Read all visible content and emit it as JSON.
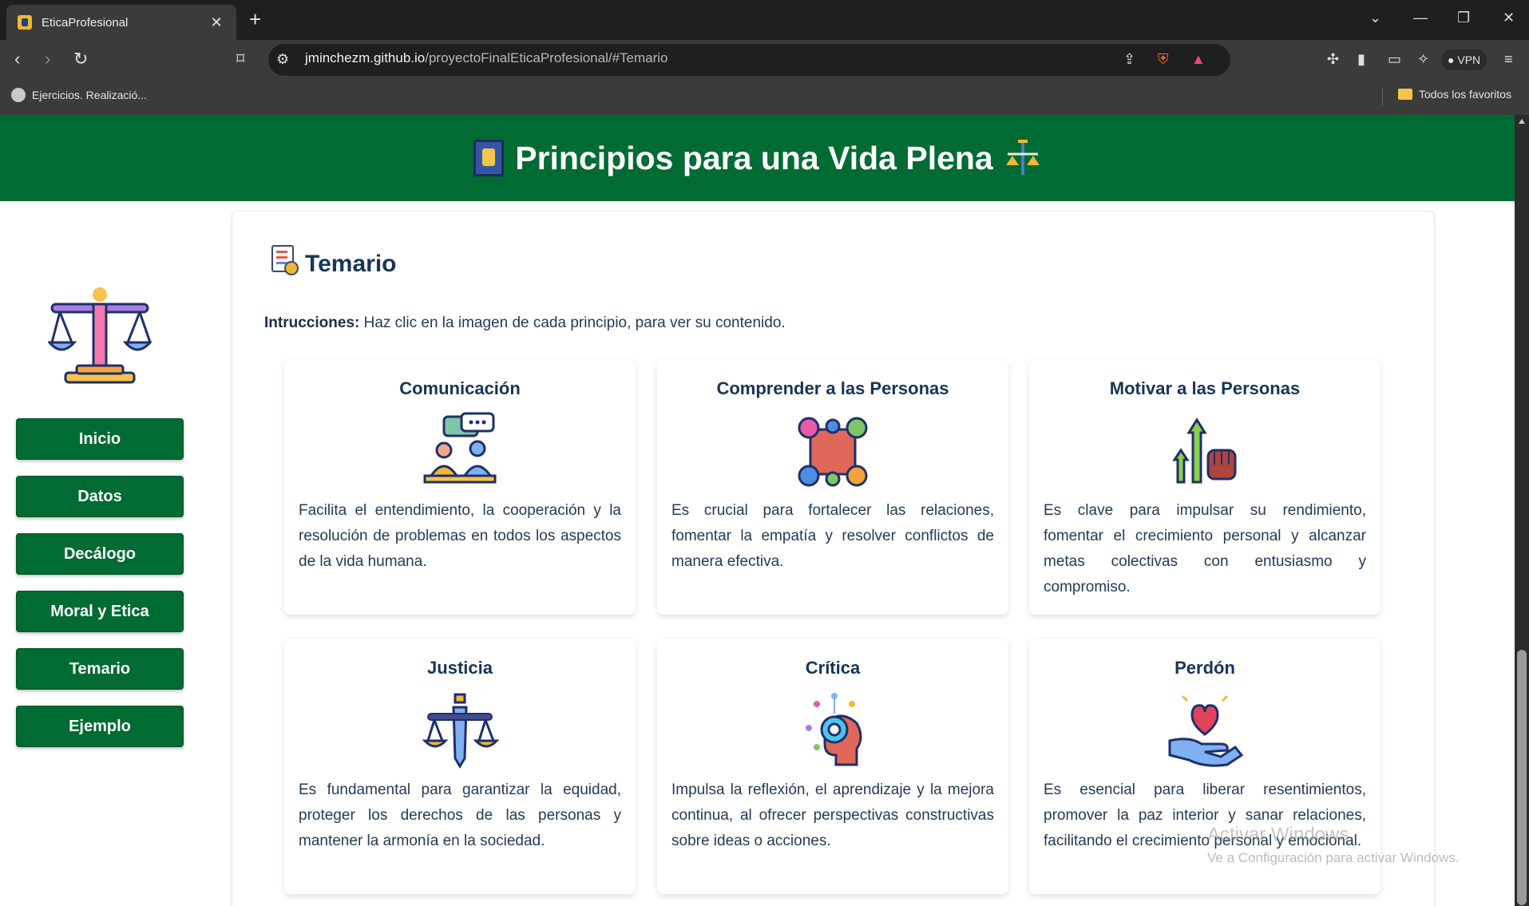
{
  "browser": {
    "tab_title": "EticaProfesional",
    "url_host": "jminchezm.github.io",
    "url_path": "/proyectoFinalEticaProfesional/#Temario",
    "vpn_label": "VPN",
    "bookmark_left": "Ejercicios. Realizació...",
    "bookmark_right": "Todos los favoritos"
  },
  "header": {
    "title": "Principios para una Vida Plena"
  },
  "sidebar": {
    "items": [
      {
        "label": "Inicio"
      },
      {
        "label": "Datos"
      },
      {
        "label": "Decálogo"
      },
      {
        "label": "Moral y Etica"
      },
      {
        "label": "Temario"
      },
      {
        "label": "Ejemplo"
      }
    ]
  },
  "main": {
    "section_title": "Temario",
    "instructions_label": "Intrucciones:",
    "instructions_text": " Haz clic en la imagen de cada principio, para ver su contenido.",
    "principles": [
      {
        "title": "Comunicación",
        "icon": "communication-icon",
        "text": "Facilita el entendimiento, la cooperación y la resolución de problemas en todos los aspectos de la vida humana."
      },
      {
        "title": "Comprender a las Personas",
        "icon": "puzzle-people-icon",
        "text": "Es crucial para fortalecer las relaciones, fomentar la empatía y resolver conflictos de manera efectiva."
      },
      {
        "title": "Motivar a las Personas",
        "icon": "motivation-fist-icon",
        "text": "Es clave para impulsar su rendimiento, fomentar el crecimiento personal y alcanzar metas colectivas con entusiasmo y compromiso."
      },
      {
        "title": "Justicia",
        "icon": "justice-scale-icon",
        "text": "Es fundamental para garantizar la equidad, proteger los derechos de las personas y mantener la armonía en la sociedad."
      },
      {
        "title": "Crítica",
        "icon": "critical-thinking-icon",
        "text": "Impulsa la reflexión, el aprendizaje y la mejora continua, al ofrecer perspectivas constructivas sobre ideas o acciones."
      },
      {
        "title": "Perdón",
        "icon": "heart-hand-icon",
        "text": "Es esencial para liberar resentimientos, promover la paz interior y sanar relaciones, facilitando el crecimiento personal y emocional."
      }
    ]
  },
  "watermark": {
    "line1": "Activar Windows",
    "line2": "Ve a Configuración para activar Windows."
  },
  "colors": {
    "brand_green": "#006b32",
    "title_navy": "#173556"
  }
}
